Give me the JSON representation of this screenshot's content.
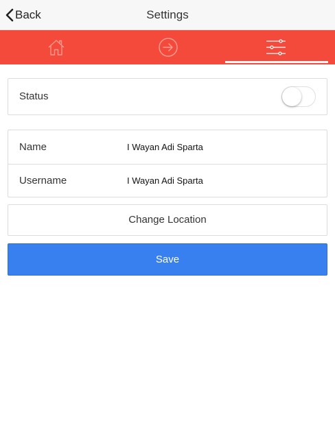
{
  "navbar": {
    "back_label": "Back",
    "title": "Settings"
  },
  "tabs": [
    {
      "icon": "home-icon",
      "active": false
    },
    {
      "icon": "sign-in-icon",
      "active": false
    },
    {
      "icon": "sliders-icon",
      "active": true
    }
  ],
  "status": {
    "label": "Status",
    "enabled": false
  },
  "profile": {
    "name_label": "Name",
    "name_value": "I Wayan Adi Sparta",
    "username_label": "Username",
    "username_value": "I Wayan Adi Sparta"
  },
  "actions": {
    "change_location_label": "Change Location",
    "save_label": "Save"
  },
  "colors": {
    "tabbar": "#f44a3c",
    "save_button": "#3880f0",
    "tab_icon": "#f79a90"
  }
}
